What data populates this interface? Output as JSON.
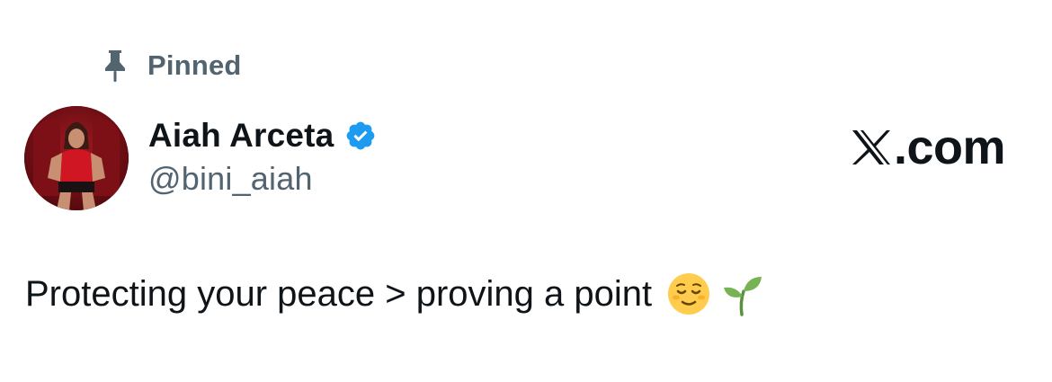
{
  "pinned": {
    "label": "Pinned",
    "icon": "pin-icon"
  },
  "author": {
    "display_name": "Aiah Arceta",
    "handle": "@bini_aiah",
    "verified": true,
    "verified_icon": "verified-badge-icon",
    "avatar": "avatar"
  },
  "brand": {
    "logo_icon": "x-logo-icon",
    "suffix": ".com"
  },
  "tweet": {
    "text": "Protecting your peace > proving a point",
    "emojis": [
      "relieved-face-emoji",
      "seedling-emoji"
    ]
  },
  "colors": {
    "text_primary": "#0f1419",
    "text_secondary": "#536471",
    "verified_blue": "#1d9bf0",
    "background": "#ffffff"
  }
}
